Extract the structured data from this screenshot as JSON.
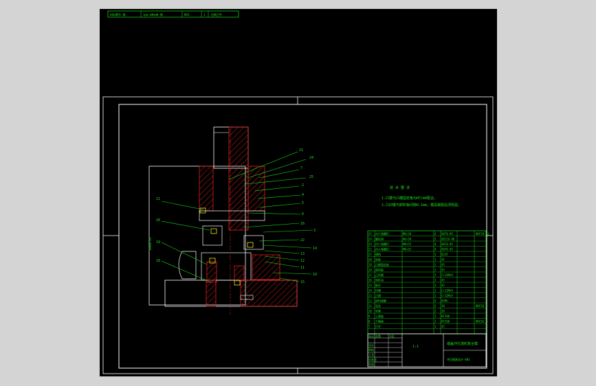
{
  "canvas": {
    "background": "#000000",
    "outer_background": "#d4d4d4"
  },
  "colors": {
    "frame": "#ffffff",
    "text": "#19e619",
    "section": "#e02020",
    "callout": "#19e619",
    "part": "#ffffff",
    "fastener": "#e6e619"
  },
  "top_note": {
    "cells": [
      "材料牌号-钢",
      "Ipm-d单m单-钢",
      "KDS",
      "I",
      "拉钢工件"
    ]
  },
  "tech_req": {
    "title": "技 术 要 求",
    "lines": [
      "1.凸模与凸模固定板为H7/m6配合。",
      "2.凸凹模与卸料板间隙0.1mm，模具装配后须检验。"
    ]
  },
  "part_labels": [
    "21",
    "24",
    "7",
    "25",
    "2",
    "4",
    "5",
    "6",
    "16",
    "3",
    "22",
    "14",
    "13",
    "12",
    "11",
    "10",
    "15",
    "23",
    "20",
    "19",
    "18"
  ],
  "left_labels": [
    "21",
    "20",
    "19",
    "18"
  ],
  "left_dim": "180±0.05",
  "bom": {
    "rows": [
      [
        "25",
        "内六角螺钉",
        "M6×20",
        "4",
        "GB70-85"
      ],
      [
        "24",
        "圆柱销",
        "Φ6×30",
        "2",
        "GB119-86"
      ],
      [
        "23",
        "内六角螺钉",
        "M8×55",
        "4",
        "GB70-85"
      ],
      [
        "22",
        "内六角螺钉",
        "M8×35",
        "4",
        "GB70-85"
      ],
      [
        "21",
        "模柄",
        "",
        "1",
        "Q235"
      ],
      [
        "20",
        "垫板",
        "",
        "1",
        "45"
      ],
      [
        "19",
        "凸模固定板",
        "",
        "1",
        "45"
      ],
      [
        "18",
        "卸料板",
        "",
        "1",
        "45"
      ],
      [
        "17",
        "凸凹模",
        "",
        "1",
        "Cr12MoV"
      ],
      [
        "16",
        "顶件块",
        "",
        "1",
        "45"
      ],
      [
        "15",
        "推杆",
        "",
        "3",
        "45"
      ],
      [
        "14",
        "凹模",
        "",
        "1",
        "Cr12MoV"
      ],
      [
        "13",
        "凸模",
        "",
        "1",
        "Cr12MoV"
      ],
      [
        "12",
        "卸料弹簧",
        "",
        "4",
        "65Mn"
      ],
      [
        "11",
        "导柱",
        "",
        "2",
        "20"
      ],
      [
        "10",
        "导套",
        "",
        "2",
        "20"
      ],
      [
        "9",
        "上模座",
        "",
        "1",
        "HT200"
      ],
      [
        "8",
        "下模座",
        "",
        "1",
        "HT200"
      ],
      [
        "7",
        "打杆",
        "",
        "1",
        "45"
      ]
    ],
    "right_notes": [
      "HRC58-62",
      "",
      "",
      "",
      "",
      "",
      "",
      "",
      "",
      "",
      "",
      "",
      "",
      "",
      "HRC58",
      "",
      "",
      "HRC56",
      "",
      ""
    ]
  },
  "title_block": {
    "title": "端盖冲孔落料复合模",
    "drawing_no": "冲压模具设计-001",
    "scale": "1:1",
    "header_cells": [
      "标记",
      "处数",
      "分区",
      "更改文件号",
      "签名",
      "日期"
    ],
    "rows": [
      "设计",
      "审核",
      "工艺",
      "标准化",
      "批准"
    ]
  }
}
